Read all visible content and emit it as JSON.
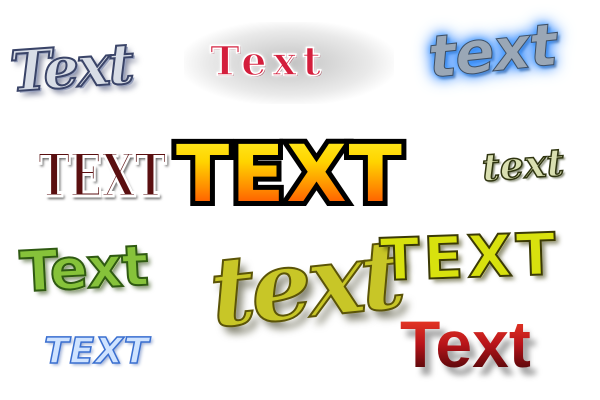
{
  "samples": [
    {
      "id": "steel-handwritten",
      "text": "Text",
      "color": "#d8dde6"
    },
    {
      "id": "red-pill-outline",
      "text": "Text",
      "color": "#d41e3c"
    },
    {
      "id": "blue-glow",
      "text": "text",
      "color": "#4aa3ff"
    },
    {
      "id": "grunge-dark-red",
      "text": "TEXT",
      "color": "#5a0f10"
    },
    {
      "id": "fire-gradient",
      "text": "TEXT",
      "color": "#ff8a00"
    },
    {
      "id": "olive-outline-small",
      "text": "text",
      "color": "#d9dfb0"
    },
    {
      "id": "green-grunge",
      "text": "Text",
      "color": "#86c23a"
    },
    {
      "id": "gold-script",
      "text": "text",
      "color": "#c8c627"
    },
    {
      "id": "blue-italic-small",
      "text": "TEXT",
      "color": "#3a6fd0"
    },
    {
      "id": "yellow-gritty",
      "text": "TEXT",
      "color": "#d8e10e"
    },
    {
      "id": "dark-red-gradient",
      "text": "Text",
      "color": "#b8141a"
    }
  ]
}
